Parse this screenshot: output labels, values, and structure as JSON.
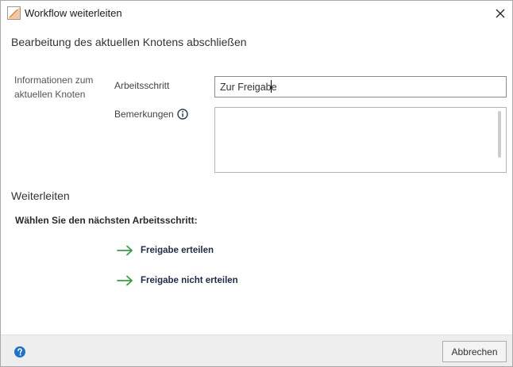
{
  "window": {
    "title": "Workflow weiterleiten"
  },
  "main": {
    "heading": "Bearbeitung des aktuellen Knotens abschließen",
    "info_label": "Informationen zum aktuellen Knoten",
    "step_label": "Arbeitsschritt",
    "step_value": "Zur Freigabe",
    "remarks_label": "Bemerkungen",
    "remarks_value": ""
  },
  "forward": {
    "heading": "Weiterleiten",
    "choose_label": "Wählen Sie den nächsten Arbeitsschritt:",
    "steps": [
      {
        "label": "Freigabe erteilen",
        "icon": "arrow-right-icon"
      },
      {
        "label": "Freigabe nicht erteilen",
        "icon": "arrow-right-icon"
      }
    ]
  },
  "footer": {
    "cancel_label": "Abbrechen"
  },
  "colors": {
    "arrow": "#3a9b46",
    "help": "#1e73c8",
    "footer_bg": "#eeeeee"
  }
}
